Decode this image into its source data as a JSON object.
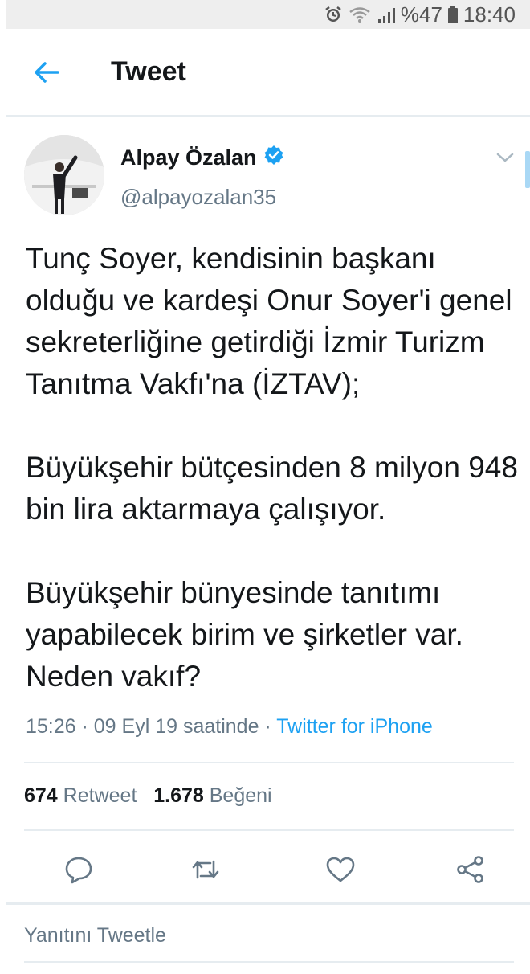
{
  "status_bar": {
    "battery": "%47",
    "time": "18:40",
    "icons": [
      "alarm-icon",
      "wifi-icon",
      "signal-icon",
      "battery-icon"
    ]
  },
  "app_bar": {
    "back_icon": "arrow-left-icon",
    "title": "Tweet"
  },
  "tweet": {
    "author": {
      "name": "Alpay Özalan",
      "handle": "@alpayozalan35",
      "verified": true
    },
    "paragraphs": [
      "Tunç Soyer, kendisinin başkanı olduğu ve kardeşi Onur Soyer'i genel sekreterliğine getirdiği İzmir Turizm Tanıtma Vakfı'na (İZTAV);",
      "Büyükşehir bütçesinden 8 milyon 948 bin lira aktarmaya çalışıyor.",
      "Büyükşehir bünyesinde tanıtımı yapabilecek birim ve şirketler var. Neden vakıf?"
    ],
    "timestamp": "15:26 · 09 Eyl 19 saatinde · ",
    "source": "Twitter for iPhone",
    "stats": {
      "retweets_count": "674",
      "retweets_label": "Retweet",
      "likes_count": "1.678",
      "likes_label": "Beğeni"
    },
    "actions": [
      "reply-icon",
      "retweet-icon",
      "like-icon",
      "share-icon"
    ]
  },
  "reply": {
    "placeholder": "Yanıtını Tweetle"
  },
  "colors": {
    "accent": "#1da1f2",
    "secondary_text": "#657786",
    "divider": "#e6ecf0"
  }
}
